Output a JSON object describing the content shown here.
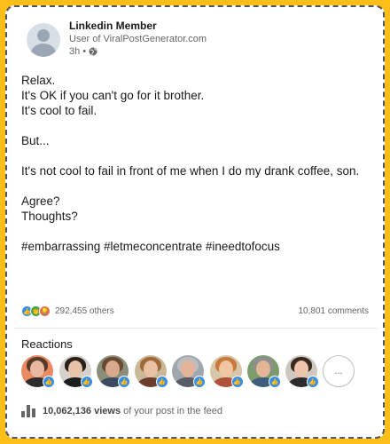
{
  "post": {
    "author": "Linkedin Member",
    "subtitle": "User of ViralPostGenerator.com",
    "time": "3h",
    "separator": "•",
    "lines": [
      "Relax.",
      "It's OK if you can't go for it brother.",
      "It's cool to fail.",
      "",
      "But...",
      "",
      "It's not cool to fail in front of me when I do my drank coffee, son.",
      "",
      "Agree?",
      "Thoughts?",
      "",
      "#embarrassing #letmeconcentrate #ineedtofocus"
    ]
  },
  "engagement": {
    "reaction_count": "292,455 others",
    "comments": "10,801 comments"
  },
  "reactions": {
    "title": "Reactions",
    "more_label": "...",
    "people": [
      {
        "skin": "#e8b9a0",
        "hair": "#5a3b2a",
        "shirt": "#2d2d2d",
        "bg": "#e98a62"
      },
      {
        "skin": "#e7c3a8",
        "hair": "#2a211d",
        "shirt": "#1d1d1d",
        "bg": "#d6d2cb"
      },
      {
        "skin": "#d9a98d",
        "hair": "#6b4a33",
        "shirt": "#3b4a5e",
        "bg": "#8b8f7a"
      },
      {
        "skin": "#e9c1a5",
        "hair": "#a06a3c",
        "shirt": "#6a3d2c",
        "bg": "#c9b896"
      },
      {
        "skin": "#e3b49a",
        "hair": "#bdbdbd",
        "shirt": "#575c66",
        "bg": "#9fa6ad"
      },
      {
        "skin": "#f0c6a5",
        "hair": "#c87a3c",
        "shirt": "#b0523a",
        "bg": "#d7c6a8"
      },
      {
        "skin": "#e2b596",
        "hair": "#8f8f8f",
        "shirt": "#3d5e7d",
        "bg": "#7d9c6b"
      },
      {
        "skin": "#ecc5aa",
        "hair": "#3a2a22",
        "shirt": "#2c2c2c",
        "bg": "#cfc8bf"
      }
    ]
  },
  "views": {
    "count": "10,062,136 views",
    "suffix": "of your post in the feed"
  },
  "colors": {
    "frame": "#fdbe1a",
    "like_blue": "#378fe9"
  }
}
